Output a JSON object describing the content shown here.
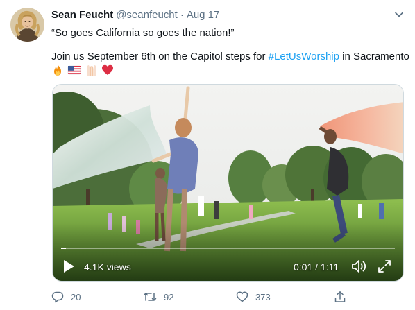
{
  "tweet": {
    "author_name": "Sean Feucht",
    "author_handle": "@seanfeucht",
    "separator": "·",
    "date": "Aug 17",
    "line1": "“So goes California so goes the nation!”",
    "line2_prefix": "Join us September 6th on the Capitol steps for ",
    "hashtag": "#LetUsWorship",
    "line2_suffix": " in Sacramento",
    "emojis": [
      "fire",
      "us-flag",
      "raised-hands",
      "red-heart"
    ]
  },
  "video": {
    "views": "4.1K views",
    "time": "0:01 / 1:11",
    "progress": 0.014
  },
  "actions": {
    "reply_count": "20",
    "retweet_count": "92",
    "like_count": "373"
  },
  "colors": {
    "link": "#1da1f2",
    "secondary_text": "#5b7083",
    "primary_text": "#0f1419"
  }
}
